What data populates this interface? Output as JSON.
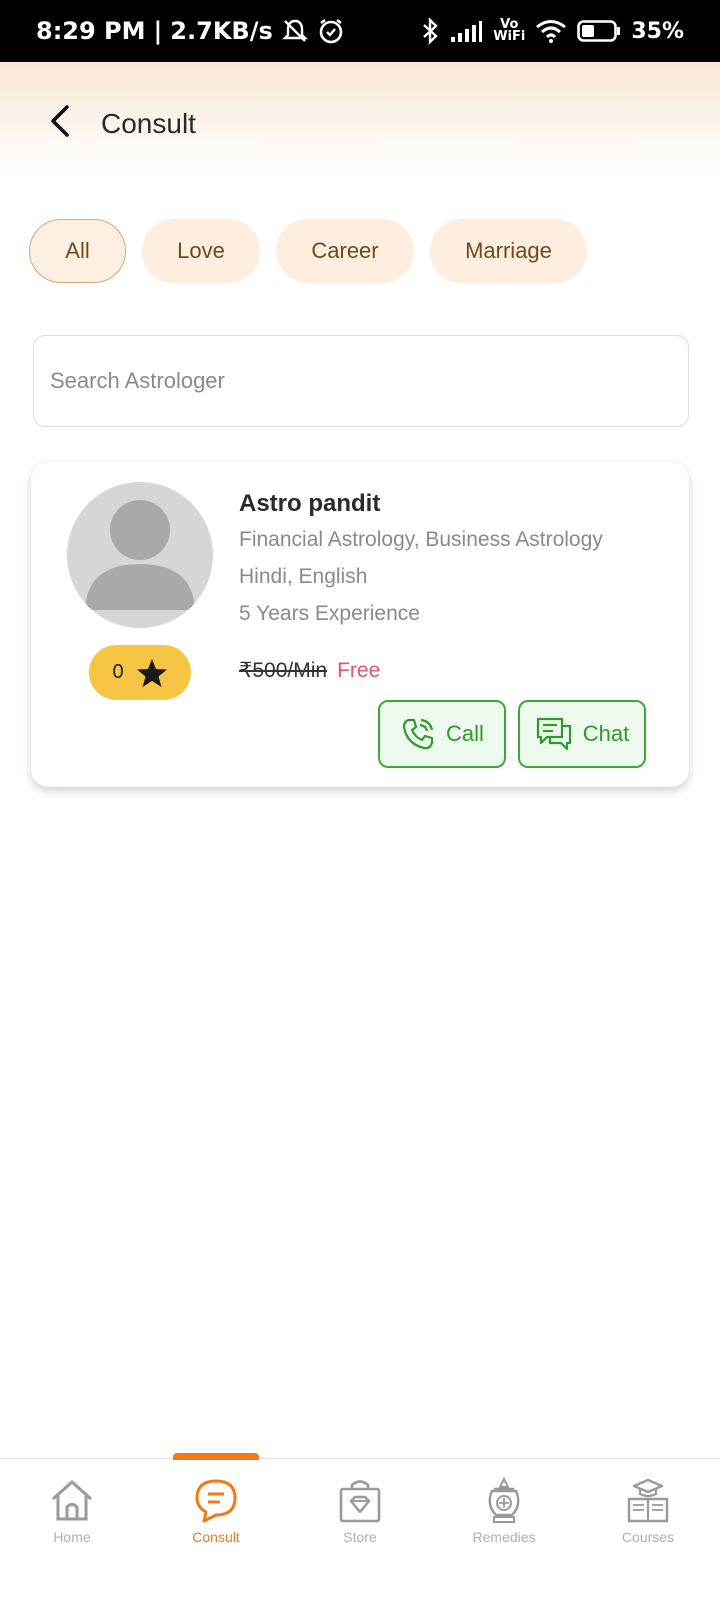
{
  "status_bar": {
    "time": "8:29 PM",
    "speed": "2.7KB/s",
    "vowifi": "Vo\nWiFi",
    "battery": "35%"
  },
  "header": {
    "title": "Consult"
  },
  "chips": [
    {
      "label": "All",
      "active": true
    },
    {
      "label": "Love",
      "active": false
    },
    {
      "label": "Career",
      "active": false
    },
    {
      "label": "Marriage",
      "active": false
    }
  ],
  "search": {
    "placeholder": "Search Astrologer",
    "value": ""
  },
  "astrologer": {
    "name": "Astro pandit",
    "specialties": "Financial Astrology, Business Astrology",
    "languages": "Hindi, English",
    "experience": "5 Years Experience",
    "rating": "0",
    "price_original": "₹500/Min",
    "price_current": "Free",
    "call_label": "Call",
    "chat_label": "Chat"
  },
  "bottom_nav": [
    {
      "label": "Home",
      "icon": "home-icon",
      "active": false
    },
    {
      "label": "Consult",
      "icon": "consult-icon",
      "active": true
    },
    {
      "label": "Store",
      "icon": "store-icon",
      "active": false
    },
    {
      "label": "Remedies",
      "icon": "remedies-icon",
      "active": false
    },
    {
      "label": "Courses",
      "icon": "courses-icon",
      "active": false
    }
  ],
  "colors": {
    "accent": "#f07a1a",
    "chip_bg": "#fdeee0",
    "call_green": "#3aaa35",
    "rating_yellow": "#f6c544",
    "free_red": "#e0566d"
  }
}
